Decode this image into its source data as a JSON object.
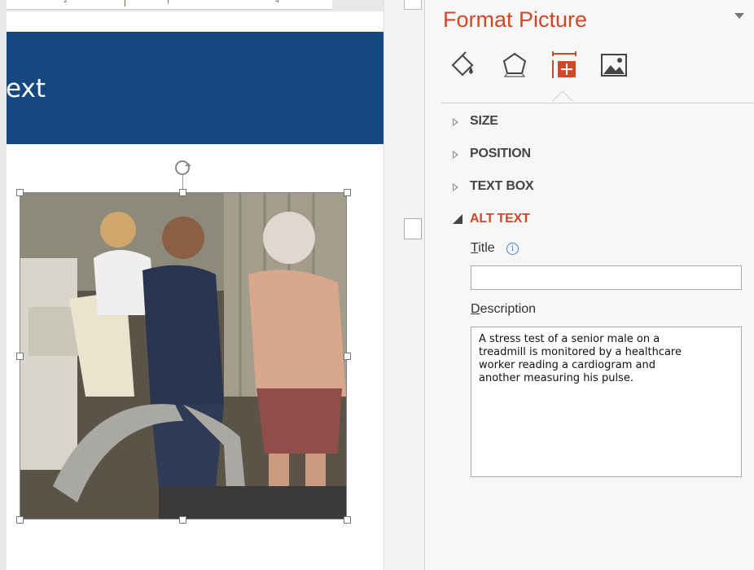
{
  "slide": {
    "title_fragment": "ext",
    "ruler_numbers": [
      "2",
      "4"
    ]
  },
  "pane": {
    "title": "Format Picture",
    "tabs": [
      {
        "icon": "fill-line-icon"
      },
      {
        "icon": "effects-icon"
      },
      {
        "icon": "size-properties-icon",
        "active": true
      },
      {
        "icon": "picture-icon"
      }
    ],
    "sections": [
      {
        "label": "SIZE",
        "expanded": false
      },
      {
        "label": "POSITION",
        "expanded": false
      },
      {
        "label": "TEXT BOX",
        "expanded": false
      },
      {
        "label": "ALT TEXT",
        "expanded": true
      }
    ],
    "alt_text": {
      "title_label_first": "T",
      "title_label_rest": "itle",
      "title_value": "",
      "description_label_first": "D",
      "description_label_rest": "escription",
      "description_value": "A stress test of a senior male on a\ntreadmill is monitored by a healthcare\nworker reading a cardiogram and\nanother measuring his pulse."
    }
  },
  "colors": {
    "accent": "#d24726",
    "slide_title_bar": "#17487f",
    "info_icon": "#3f87d4"
  }
}
